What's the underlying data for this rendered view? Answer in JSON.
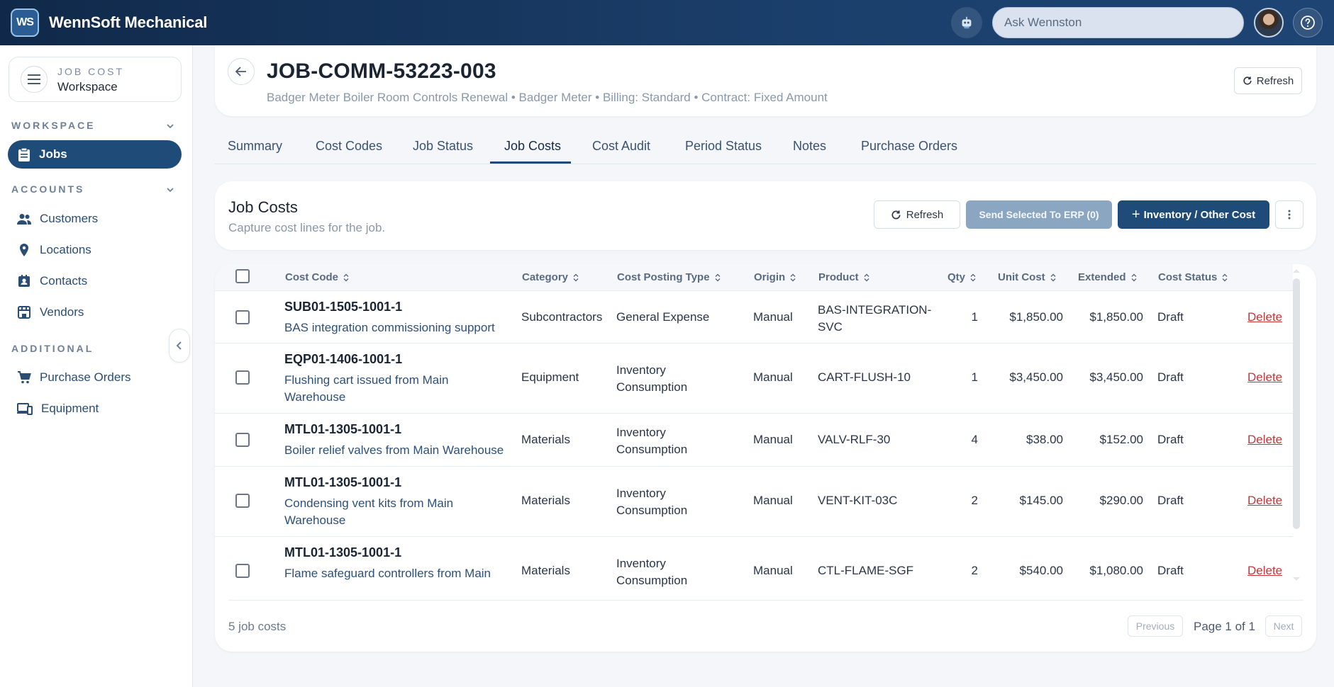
{
  "app": {
    "logo_text": "WS",
    "title": "WennSoft Mechanical"
  },
  "topbar": {
    "ask_placeholder": "Ask Wennston",
    "bot_icon": "robot-icon",
    "help_icon": "help-circle-icon"
  },
  "sidebar": {
    "workspace_card": {
      "overline": "JOB COST",
      "title": "Workspace"
    },
    "sections": [
      {
        "label": "WORKSPACE",
        "items": [
          {
            "label": "Jobs",
            "icon": "clipboard-icon",
            "active": true
          }
        ]
      },
      {
        "label": "ACCOUNTS",
        "items": [
          {
            "label": "Customers",
            "icon": "people-icon"
          },
          {
            "label": "Locations",
            "icon": "map-pin-icon"
          },
          {
            "label": "Contacts",
            "icon": "contact-card-icon"
          },
          {
            "label": "Vendors",
            "icon": "storefront-icon"
          }
        ]
      },
      {
        "label": "ADDITIONAL",
        "items": [
          {
            "label": "Purchase Orders",
            "icon": "cart-icon"
          },
          {
            "label": "Equipment",
            "icon": "devices-icon"
          }
        ]
      }
    ]
  },
  "header": {
    "job_id": "JOB-COMM-53223-003",
    "subtitle": "Badger Meter Boiler Room Controls Renewal • Badger Meter • Billing: Standard • Contract: Fixed Amount",
    "refresh_label": "Refresh"
  },
  "tabs": [
    "Summary",
    "Cost Codes",
    "Job Status",
    "Job Costs",
    "Cost Audit",
    "Period Status",
    "Notes",
    "Purchase Orders"
  ],
  "active_tab": "Job Costs",
  "job_costs": {
    "title": "Job Costs",
    "subtitle": "Capture cost lines for the job.",
    "refresh_label": "Refresh",
    "send_label": "Send Selected To ERP (0)",
    "add_label": "Inventory / Other Cost"
  },
  "table": {
    "columns": [
      "Cost Code",
      "Category",
      "Cost Posting Type",
      "Origin",
      "Product",
      "Qty",
      "Unit Cost",
      "Extended",
      "Cost Status"
    ],
    "rows": [
      {
        "code": "SUB01-1505-1001-1",
        "desc": [
          "BAS integration commissioning support"
        ],
        "category": "Subcontractors",
        "posting": [
          "General Expense"
        ],
        "origin": "Manual",
        "product": [
          "BAS-INTEGRATION-",
          "SVC"
        ],
        "qty": "1",
        "unit_cost": "$1,850.00",
        "extended": "$1,850.00",
        "status": "Draft",
        "action": "Delete"
      },
      {
        "code": "EQP01-1406-1001-1",
        "desc": [
          "Flushing cart issued from Main",
          "Warehouse"
        ],
        "category": "Equipment",
        "posting": [
          "Inventory",
          "Consumption"
        ],
        "origin": "Manual",
        "product": [
          "CART-FLUSH-10"
        ],
        "qty": "1",
        "unit_cost": "$3,450.00",
        "extended": "$3,450.00",
        "status": "Draft",
        "action": "Delete"
      },
      {
        "code": "MTL01-1305-1001-1",
        "desc": [
          "Boiler relief valves from Main Warehouse"
        ],
        "category": "Materials",
        "posting": [
          "Inventory",
          "Consumption"
        ],
        "origin": "Manual",
        "product": [
          "VALV-RLF-30"
        ],
        "qty": "4",
        "unit_cost": "$38.00",
        "extended": "$152.00",
        "status": "Draft",
        "action": "Delete"
      },
      {
        "code": "MTL01-1305-1001-1",
        "desc": [
          "Condensing vent kits from Main",
          "Warehouse"
        ],
        "category": "Materials",
        "posting": [
          "Inventory",
          "Consumption"
        ],
        "origin": "Manual",
        "product": [
          "VENT-KIT-03C"
        ],
        "qty": "2",
        "unit_cost": "$145.00",
        "extended": "$290.00",
        "status": "Draft",
        "action": "Delete"
      },
      {
        "code": "MTL01-1305-1001-1",
        "desc": [
          "Flame safeguard controllers from Main"
        ],
        "category": "Materials",
        "posting": [
          "Inventory",
          "Consumption"
        ],
        "origin": "Manual",
        "product": [
          "CTL-FLAME-SGF"
        ],
        "qty": "2",
        "unit_cost": "$540.00",
        "extended": "$1,080.00",
        "status": "Draft",
        "action": "Delete"
      }
    ]
  },
  "footer": {
    "count": "5 job costs",
    "previous": "Previous",
    "page": "Page 1 of 1",
    "next": "Next"
  },
  "colors": {
    "brand_dark": "#10294a",
    "primary": "#1f4b78",
    "danger": "#c6363a"
  }
}
